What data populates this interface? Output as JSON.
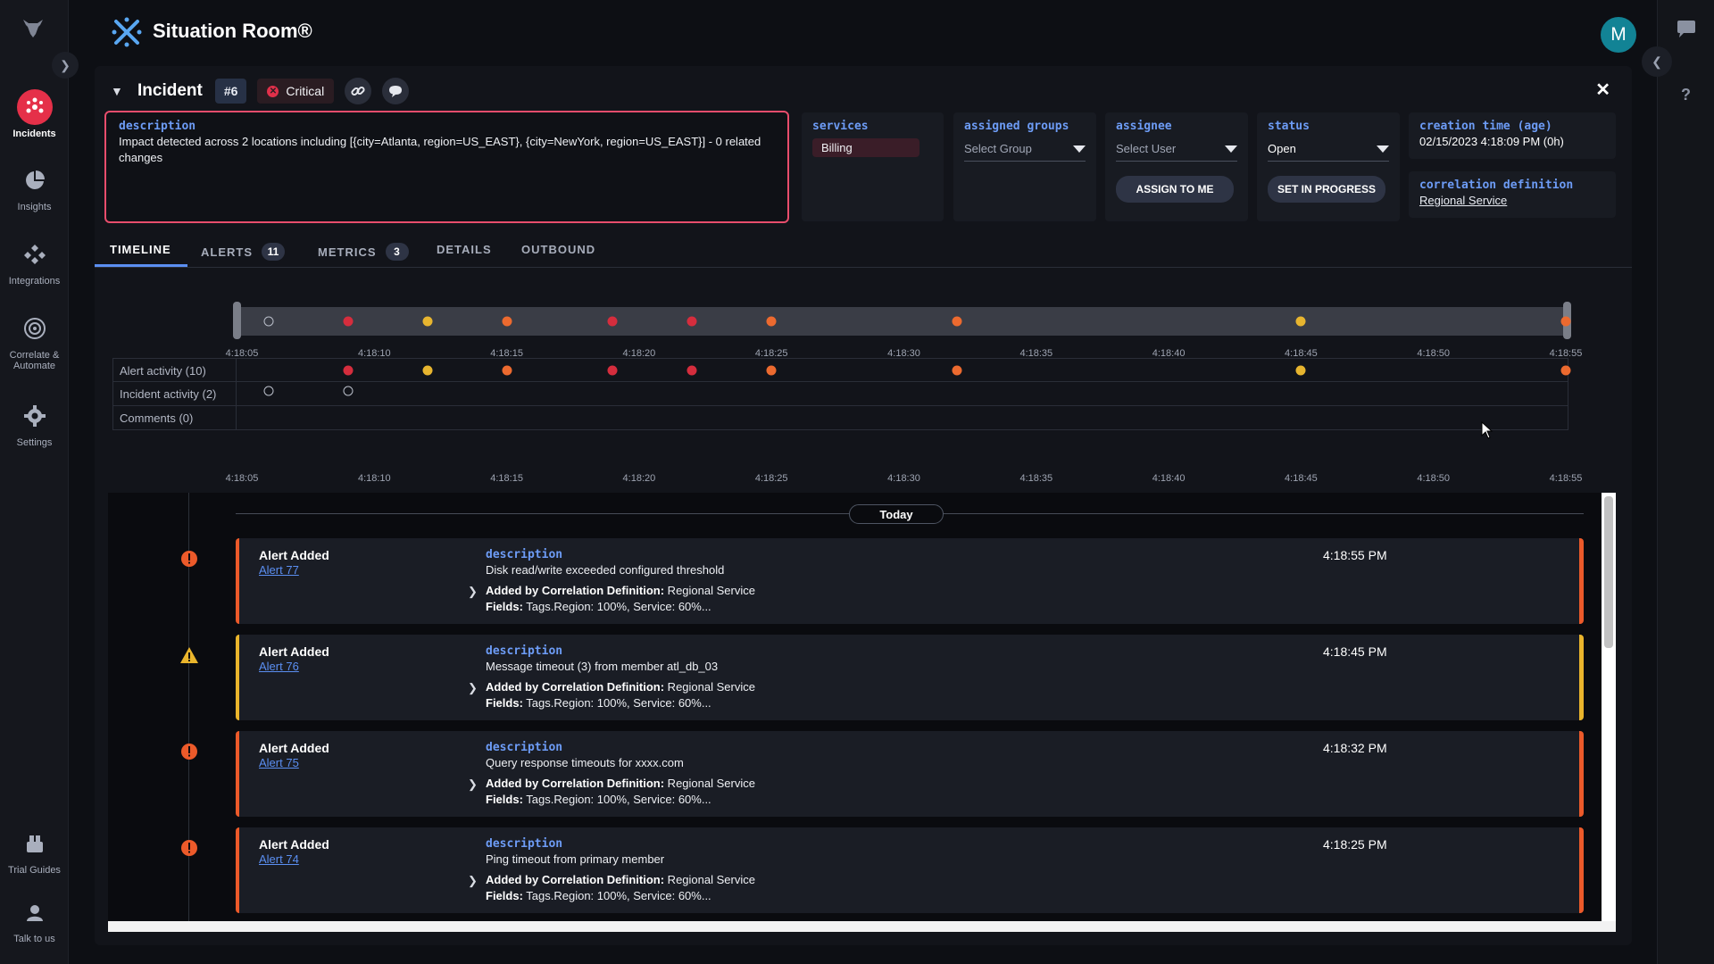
{
  "app": {
    "title": "Situation Room®",
    "avatar_initial": "M"
  },
  "nav": {
    "items": [
      {
        "label": "Incidents",
        "icon": "incidents-icon"
      },
      {
        "label": "Insights",
        "icon": "pie-chart-icon"
      },
      {
        "label": "Integrations",
        "icon": "integrations-icon"
      },
      {
        "label": "Correlate &",
        "label2": "Automate",
        "icon": "correlate-icon"
      },
      {
        "label": "Settings",
        "icon": "gear-icon"
      },
      {
        "label": "Trial Guides",
        "icon": "trial-guides-icon"
      },
      {
        "label": "Talk to us",
        "icon": "support-agent-icon"
      }
    ]
  },
  "incident": {
    "title": "Incident",
    "id": "#6",
    "severity": "Critical",
    "close": "✕"
  },
  "fields": {
    "description_label": "description",
    "description": "Impact detected across 2 locations including [{city=Atlanta, region=US_EAST}, {city=NewYork, region=US_EAST}] - 0 related changes",
    "services_label": "services",
    "services": [
      "Billing"
    ],
    "groups_label": "assigned groups",
    "groups_placeholder": "Select Group",
    "assignee_label": "assignee",
    "assignee_placeholder": "Select User",
    "assign_button": "ASSIGN TO ME",
    "status_label": "status",
    "status_value": "Open",
    "progress_button": "SET IN PROGRESS",
    "creation_label": "creation time (age)",
    "creation_value": "02/15/2023 4:18:09 PM (0h)",
    "corr_label": "correlation definition",
    "corr_value": "Regional Service"
  },
  "tabs": [
    {
      "label": "TIMELINE",
      "count": null,
      "active": true
    },
    {
      "label": "ALERTS",
      "count": "11"
    },
    {
      "label": "METRICS",
      "count": "3"
    },
    {
      "label": "DETAILS",
      "count": null
    },
    {
      "label": "OUTBOUND",
      "count": null
    }
  ],
  "timeline": {
    "ticks": [
      "4:18:05",
      "4:18:10",
      "4:18:15",
      "4:18:20",
      "4:18:25",
      "4:18:30",
      "4:18:35",
      "4:18:40",
      "4:18:45",
      "4:18:50",
      "4:18:55"
    ],
    "rows": [
      {
        "label": "Alert activity (10)"
      },
      {
        "label": "Incident activity (2)"
      },
      {
        "label": "Comments (0)"
      }
    ],
    "alert_points": [
      {
        "t": 9.0,
        "color": "red"
      },
      {
        "t": 12.0,
        "color": "yellow"
      },
      {
        "t": 15.0,
        "color": "orange"
      },
      {
        "t": 19.0,
        "color": "red"
      },
      {
        "t": 22.0,
        "color": "red"
      },
      {
        "t": 25.0,
        "color": "orange"
      },
      {
        "t": 32.0,
        "color": "orange"
      },
      {
        "t": 45.0,
        "color": "yellow"
      },
      {
        "t": 55.0,
        "color": "orange"
      }
    ],
    "incident_points": [
      {
        "t": 6.0
      },
      {
        "t": 9.0
      }
    ],
    "range": [
      5,
      55
    ]
  },
  "feed": {
    "day_label": "Today",
    "events": [
      {
        "type": "Alert Added",
        "link": "Alert 77",
        "desc_label": "description",
        "desc": "Disk read/write exceeded configured threshold",
        "corr_prefix": "Added by Correlation Definition:",
        "corr": " Regional Service",
        "fields_prefix": "Fields:",
        "fields": " Tags.Region: 100%, Service: 60%...",
        "time": "4:18:55 PM",
        "severity": "error"
      },
      {
        "type": "Alert Added",
        "link": "Alert 76",
        "desc_label": "description",
        "desc": "Message timeout (3) from member atl_db_03",
        "corr_prefix": "Added by Correlation Definition:",
        "corr": " Regional Service",
        "fields_prefix": "Fields:",
        "fields": " Tags.Region: 100%, Service: 60%...",
        "time": "4:18:45 PM",
        "severity": "warning"
      },
      {
        "type": "Alert Added",
        "link": "Alert 75",
        "desc_label": "description",
        "desc": "Query response timeouts for xxxx.com",
        "corr_prefix": "Added by Correlation Definition:",
        "corr": " Regional Service",
        "fields_prefix": "Fields:",
        "fields": " Tags.Region: 100%, Service: 60%...",
        "time": "4:18:32 PM",
        "severity": "error"
      },
      {
        "type": "Alert Added",
        "link": "Alert 74",
        "desc_label": "description",
        "desc": "Ping timeout from primary member",
        "corr_prefix": "Added by Correlation Definition:",
        "corr": " Regional Service",
        "fields_prefix": "Fields:",
        "fields": " Tags.Region: 100%, Service: 60%...",
        "time": "4:18:25 PM",
        "severity": "error"
      }
    ]
  },
  "colors": {
    "accent": "#5b8ff2",
    "critical": "#e0304a",
    "warning": "#eab52c",
    "error": "#ec5a2a",
    "teal": "#128395"
  }
}
